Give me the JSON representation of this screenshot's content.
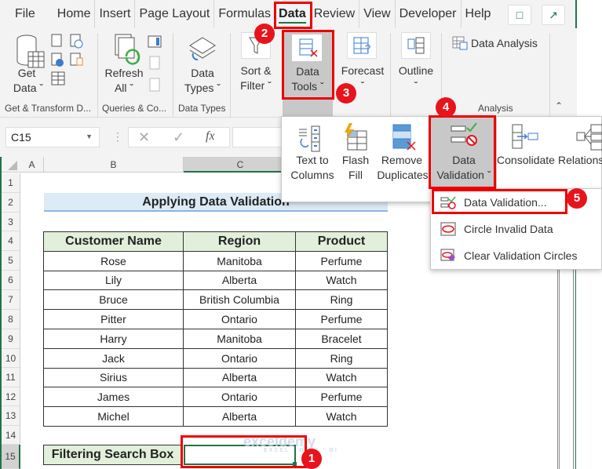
{
  "tabs": [
    {
      "label": "File"
    },
    {
      "label": "Home"
    },
    {
      "label": "Insert"
    },
    {
      "label": "Page Layout"
    },
    {
      "label": "Formulas"
    },
    {
      "label": "Data",
      "active": true
    },
    {
      "label": "Review"
    },
    {
      "label": "View"
    },
    {
      "label": "Developer"
    },
    {
      "label": "Help"
    }
  ],
  "ribbon": {
    "get_data": "Get\nData",
    "get_data_l1": "Get",
    "get_data_l2": "Data",
    "refresh_l1": "Refresh",
    "refresh_l2": "All",
    "data_types_l1": "Data",
    "data_types_l2": "Types",
    "sort_l1": "Sort &",
    "sort_l2": "Filter",
    "tools_l1": "Data",
    "tools_l2": "Tools",
    "forecast": "Forecast",
    "outline": "Outline",
    "data_analysis": "Data Analysis",
    "groups": {
      "get_transform": "Get & Transform D...",
      "queries": "Queries & Co...",
      "data_types": "Data Types",
      "analysis": "Analysis"
    }
  },
  "formula_bar": {
    "name_box": "C15",
    "fx": "fx",
    "value": ""
  },
  "columns": [
    "A",
    "B",
    "C"
  ],
  "rows": [
    "1",
    "2",
    "3",
    "4",
    "5",
    "6",
    "7",
    "8",
    "9",
    "10",
    "11",
    "12",
    "13",
    "14",
    "15"
  ],
  "sheet": {
    "title": "Applying Data Validation",
    "headers": [
      "Customer Name",
      "Region",
      "Product"
    ],
    "data": [
      [
        "Rose",
        "Manitoba",
        "Perfume"
      ],
      [
        "Lily",
        "Alberta",
        "Watch"
      ],
      [
        "Bruce",
        "British Columbia",
        "Ring"
      ],
      [
        "Pitter",
        "Ontario",
        "Perfume"
      ],
      [
        "Harry",
        "Manitoba",
        "Bracelet"
      ],
      [
        "Jack",
        "Ontario",
        "Ring"
      ],
      [
        "Sirius",
        "Alberta",
        "Watch"
      ],
      [
        "James",
        "Ontario",
        "Perfume"
      ],
      [
        "Michel",
        "Alberta",
        "Watch"
      ]
    ],
    "search_label": "Filtering Search Box",
    "search_value": ""
  },
  "data_tools_popup": {
    "text_to_columns_l1": "Text to",
    "text_to_columns_l2": "Columns",
    "flash_fill_l1": "Flash",
    "flash_fill_l2": "Fill",
    "remove_dup_l1": "Remove",
    "remove_dup_l2": "Duplicates",
    "validation_l1": "Data",
    "validation_l2": "Validation",
    "consolidate": "Consolidate",
    "relations": "Relations"
  },
  "validation_menu": [
    {
      "label": "Data Validation..."
    },
    {
      "label": "Circle Invalid Data"
    },
    {
      "label": "Clear Validation Circles"
    }
  ],
  "badges": [
    "1",
    "2",
    "3",
    "4",
    "5"
  ],
  "watermark": {
    "brand": "exceldemy",
    "tagline": "EXCEL · DATA · BI"
  },
  "colors": {
    "accent": "#217346",
    "highlight": "#e00000",
    "badge": "#e8141c"
  }
}
